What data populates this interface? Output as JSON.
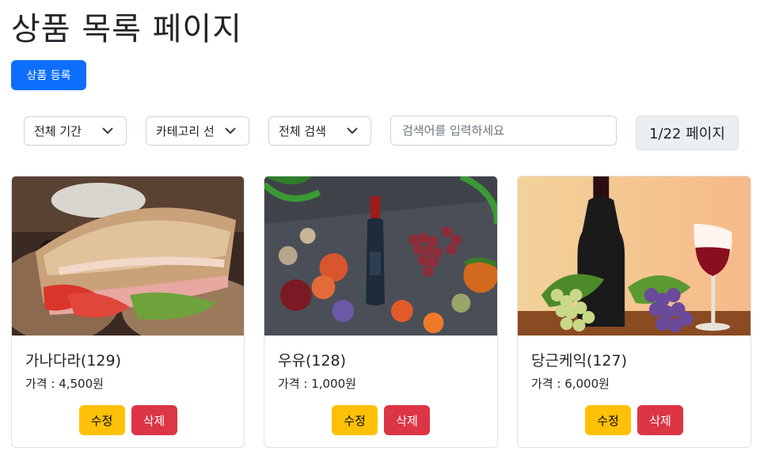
{
  "page": {
    "title": "상품 목록 페이지"
  },
  "toolbar": {
    "register_label": "상품 등록"
  },
  "filters": {
    "period": {
      "selected": "전체 기간"
    },
    "category": {
      "selected": "카테고리 선"
    },
    "search_type": {
      "selected": "전체 검색"
    },
    "search": {
      "placeholder": "검색어를 입력하세요",
      "value": ""
    },
    "page_indicator": "1/22 페이지"
  },
  "products": [
    {
      "title": "가나다라(129)",
      "price": "가격 : 4,500원",
      "edit_label": "수정",
      "delete_label": "삭제",
      "image": "sandwich"
    },
    {
      "title": "우유(128)",
      "price": "가격 : 1,000원",
      "edit_label": "수정",
      "delete_label": "삭제",
      "image": "wine-table"
    },
    {
      "title": "당근케익(127)",
      "price": "가격 : 6,000원",
      "edit_label": "수정",
      "delete_label": "삭제",
      "image": "wine-grapes"
    }
  ],
  "colors": {
    "primary": "#0d6efd",
    "warning": "#ffc107",
    "danger": "#dc3545"
  }
}
